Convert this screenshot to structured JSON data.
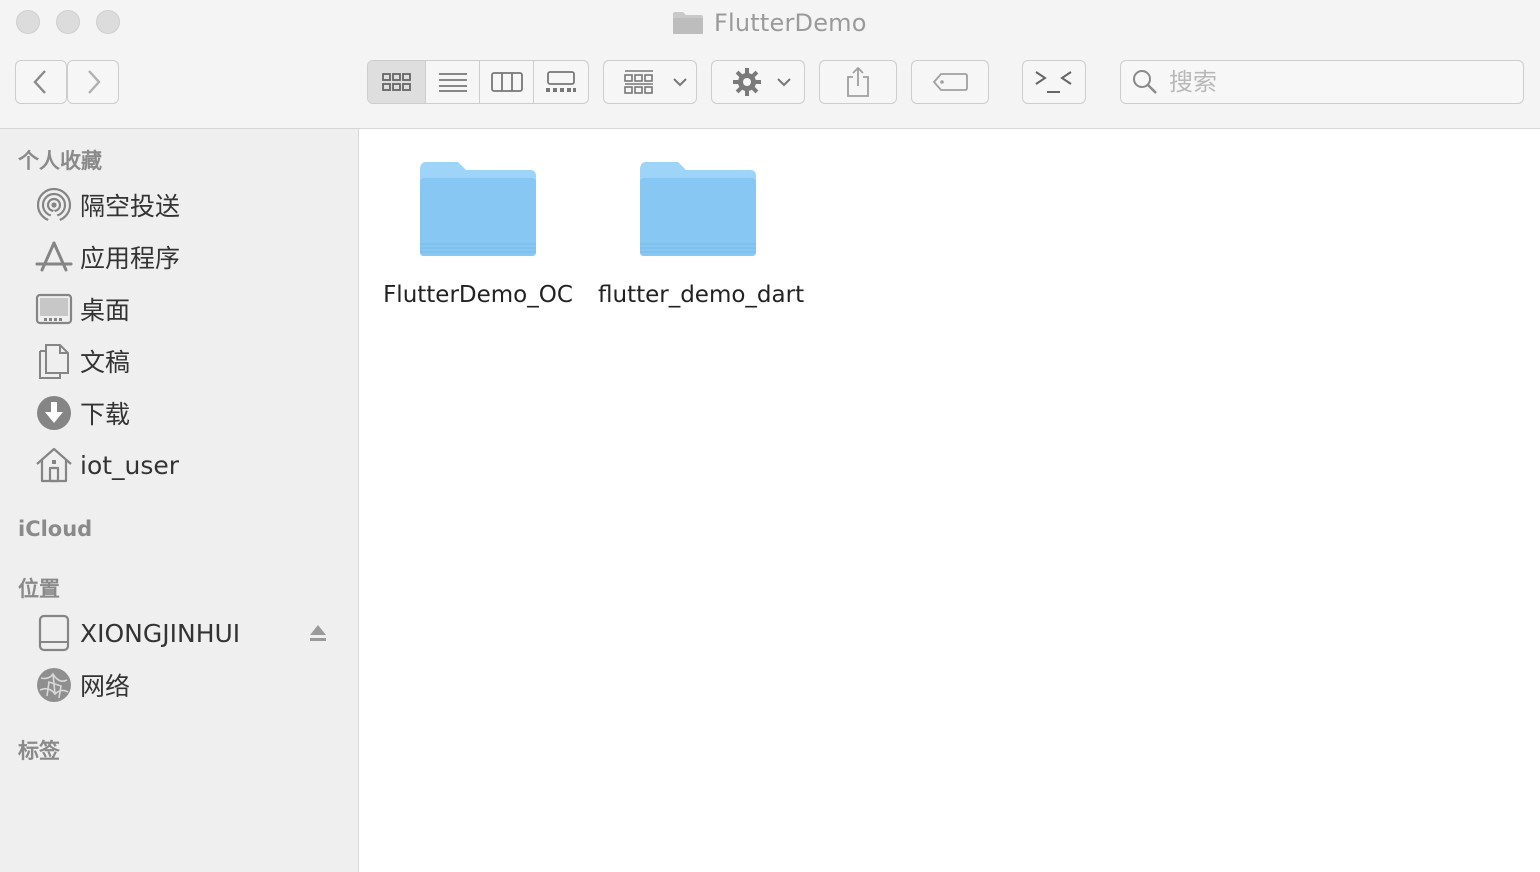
{
  "window": {
    "title": "FlutterDemo"
  },
  "toolbar": {
    "back_icon": "chevron-left-icon",
    "forward_icon": "chevron-right-icon",
    "view_modes": [
      "icon-view",
      "list-view",
      "column-view",
      "gallery-view"
    ],
    "search_placeholder": "搜索"
  },
  "sidebar": {
    "favorites_title": "个人收藏",
    "favorites": [
      {
        "label": "隔空投送",
        "icon": "airdrop-icon"
      },
      {
        "label": "应用程序",
        "icon": "applications-icon"
      },
      {
        "label": "桌面",
        "icon": "desktop-icon"
      },
      {
        "label": "文稿",
        "icon": "documents-icon"
      },
      {
        "label": "下载",
        "icon": "download-icon"
      },
      {
        "label": "iot_user",
        "icon": "home-icon"
      }
    ],
    "icloud_title": "iCloud",
    "locations_title": "位置",
    "locations": [
      {
        "label": "XIONGJINHUI",
        "icon": "drive-icon"
      },
      {
        "label": "网络",
        "icon": "network-icon"
      }
    ],
    "tags_title": "标签"
  },
  "files": [
    {
      "name": "FlutterDemo_OC",
      "icon": "folder-icon"
    },
    {
      "name": "flutter_demo_dart",
      "icon": "folder-icon"
    }
  ],
  "colors": {
    "folder_top": "#9ed4f7",
    "folder_body": "#86c7f3",
    "sidebar_bg": "#efefef",
    "toolbar_bg": "#f4f4f4"
  }
}
